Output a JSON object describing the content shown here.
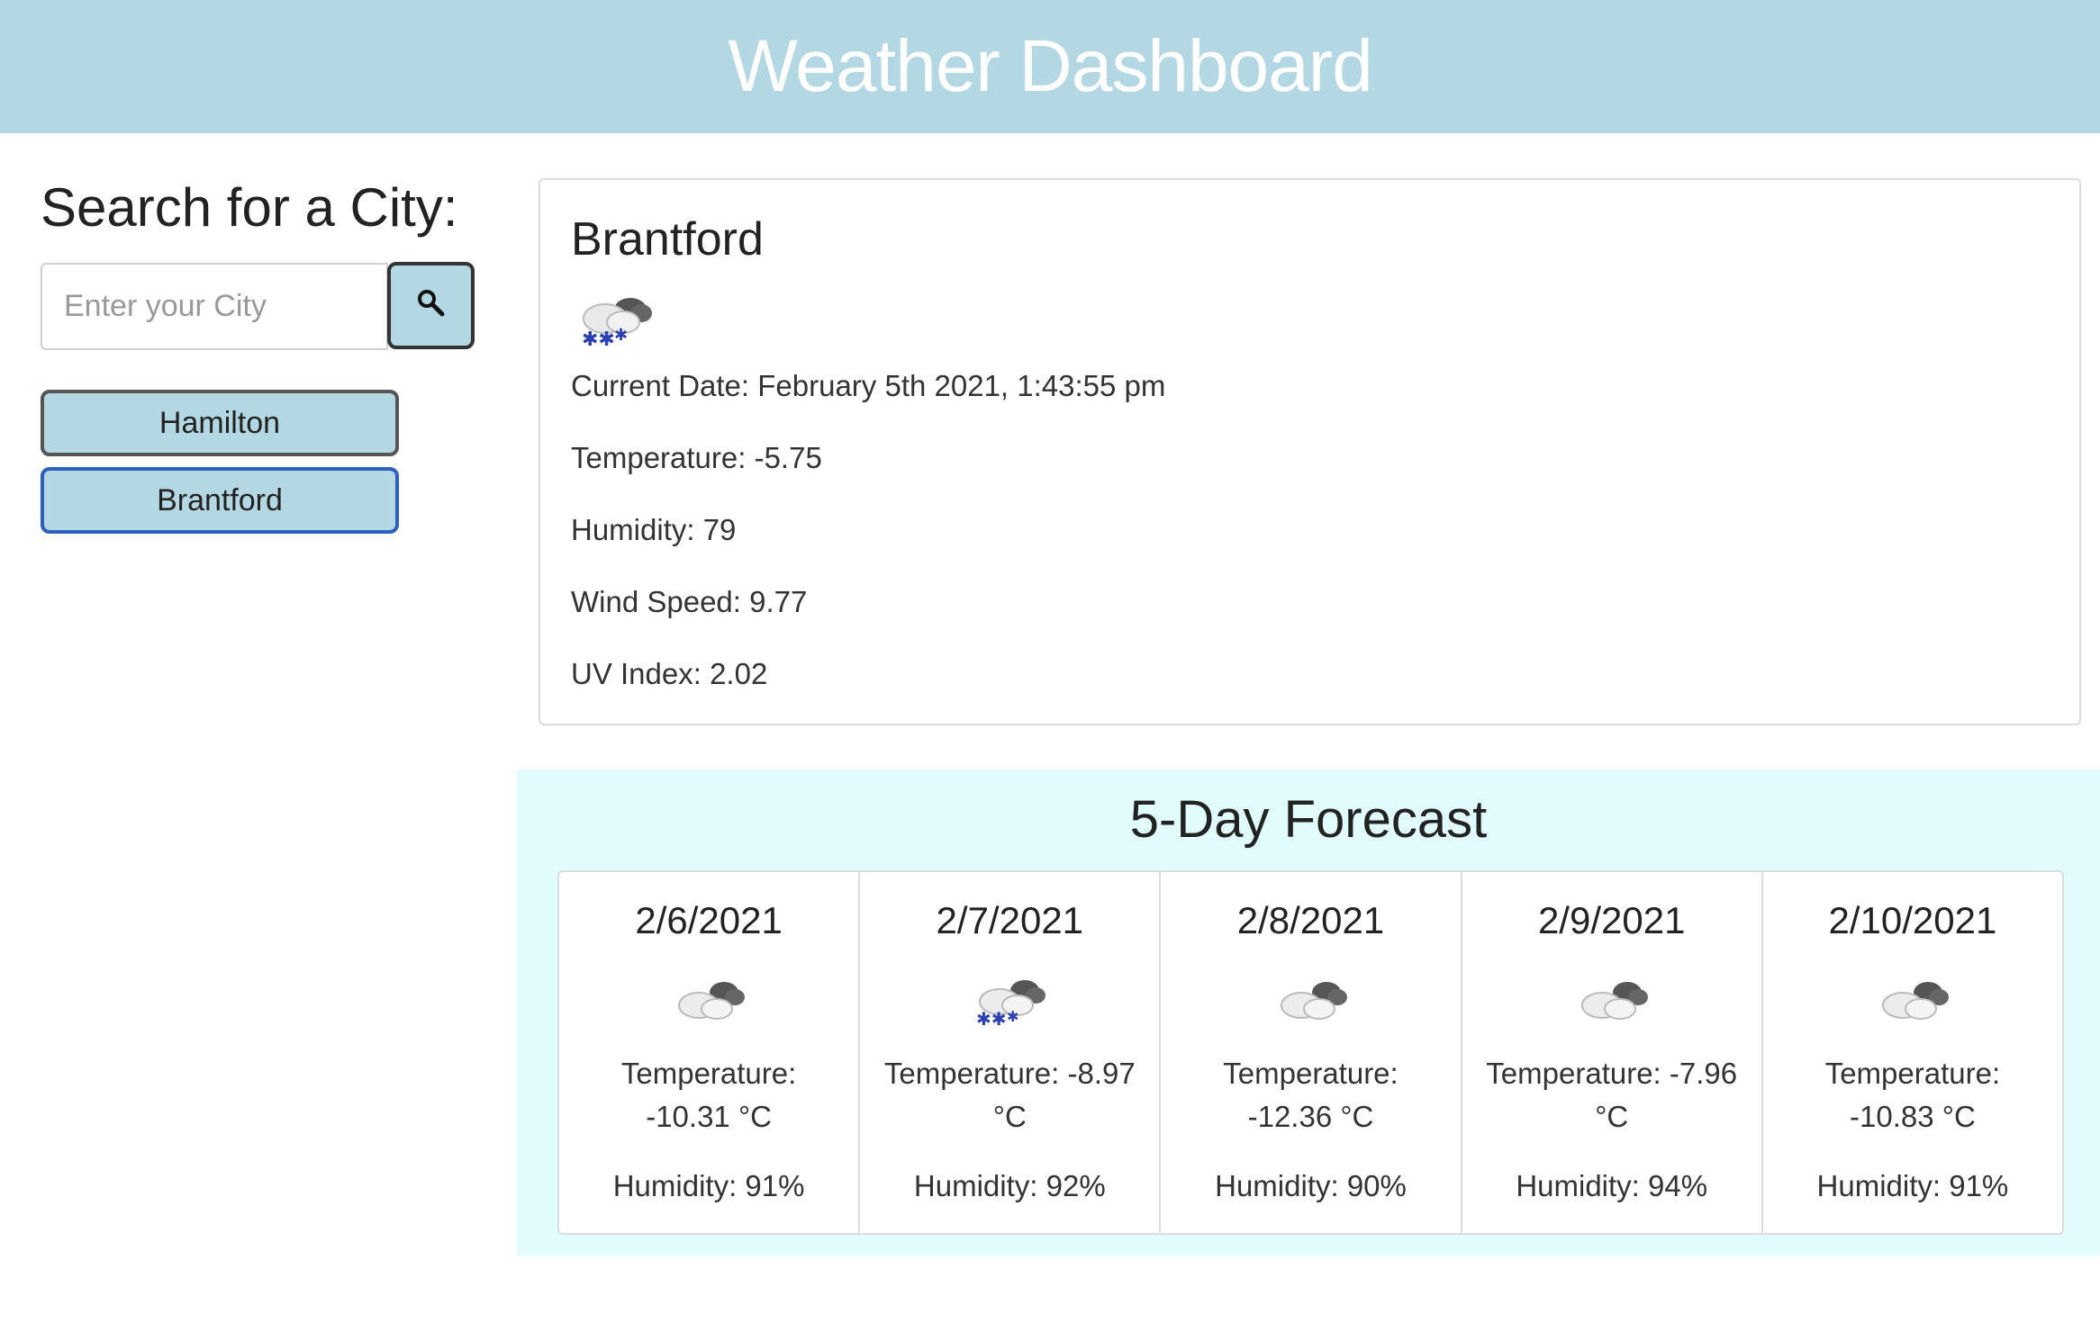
{
  "header": {
    "title": "Weather Dashboard"
  },
  "search": {
    "heading": "Search for a City:",
    "placeholder": "Enter your City",
    "button_icon": "search-icon"
  },
  "history": [
    {
      "label": "Hamilton",
      "active": false
    },
    {
      "label": "Brantford",
      "active": true
    }
  ],
  "current": {
    "city": "Brantford",
    "icon": "snow-cloud-icon",
    "date_text": "Current Date: February 5th 2021, 1:43:55 pm",
    "temperature_text": "Temperature: -5.75",
    "humidity_text": "Humidity: 79",
    "wind_text": "Wind Speed: 9.77",
    "uv_text": "UV Index: 2.02"
  },
  "forecast": {
    "title": "5-Day Forecast",
    "days": [
      {
        "date": "2/6/2021",
        "icon": "cloud-icon",
        "temperature": "Temperature: -10.31 °C",
        "humidity": "Humidity: 91%"
      },
      {
        "date": "2/7/2021",
        "icon": "snow-cloud-icon",
        "temperature": "Temperature: -8.97 °C",
        "humidity": "Humidity: 92%"
      },
      {
        "date": "2/8/2021",
        "icon": "cloud-icon",
        "temperature": "Temperature: -12.36 °C",
        "humidity": "Humidity: 90%"
      },
      {
        "date": "2/9/2021",
        "icon": "cloud-icon",
        "temperature": "Temperature: -7.96 °C",
        "humidity": "Humidity: 94%"
      },
      {
        "date": "2/10/2021",
        "icon": "cloud-icon",
        "temperature": "Temperature: -10.83 °C",
        "humidity": "Humidity: 91%"
      }
    ]
  },
  "colors": {
    "header_bg": "#b4d8e3",
    "forecast_bg": "#e0fcfc",
    "active_border": "#2d5fbf"
  }
}
